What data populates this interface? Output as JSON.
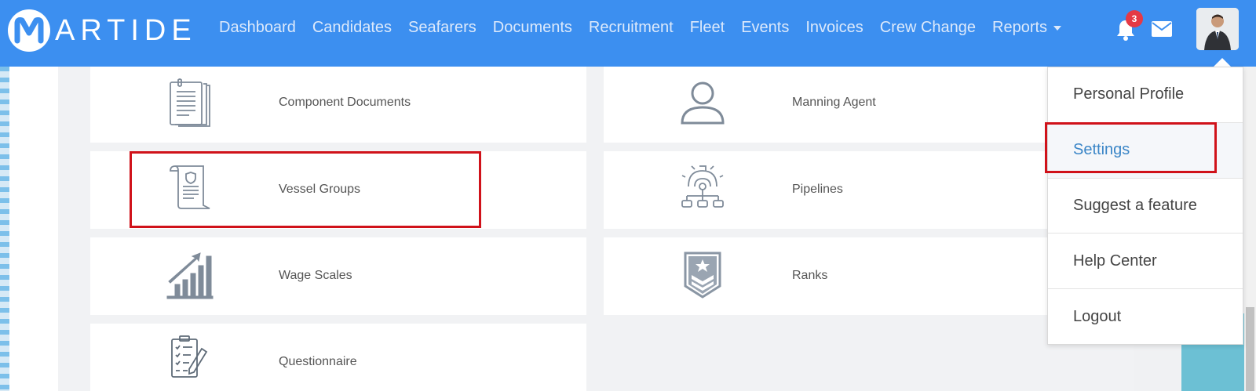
{
  "brand": {
    "logo_text": "ARTIDE"
  },
  "nav": {
    "items": [
      "Dashboard",
      "Candidates",
      "Seafarers",
      "Documents",
      "Recruitment",
      "Fleet",
      "Events",
      "Invoices",
      "Crew Change"
    ],
    "reports_label": "Reports"
  },
  "notifications": {
    "count": "3"
  },
  "cards": [
    {
      "label": "Component Documents",
      "icon": "documents-icon"
    },
    {
      "label": "Manning Agent",
      "icon": "person-icon"
    },
    {
      "label": "Vessel Groups",
      "icon": "certificate-scroll-icon"
    },
    {
      "label": "Pipelines",
      "icon": "pipeline-gear-icon"
    },
    {
      "label": "Wage Scales",
      "icon": "bar-chart-icon"
    },
    {
      "label": "Ranks",
      "icon": "rank-badge-icon"
    },
    {
      "label": "Questionnaire",
      "icon": "checklist-icon"
    }
  ],
  "dropdown": {
    "items": [
      "Personal Profile",
      "Settings",
      "Suggest a feature",
      "Help Center",
      "Logout"
    ],
    "active": "Settings"
  },
  "colors": {
    "header": "#3c8ff0",
    "highlight": "#d0121a",
    "link": "#3b86c7"
  }
}
